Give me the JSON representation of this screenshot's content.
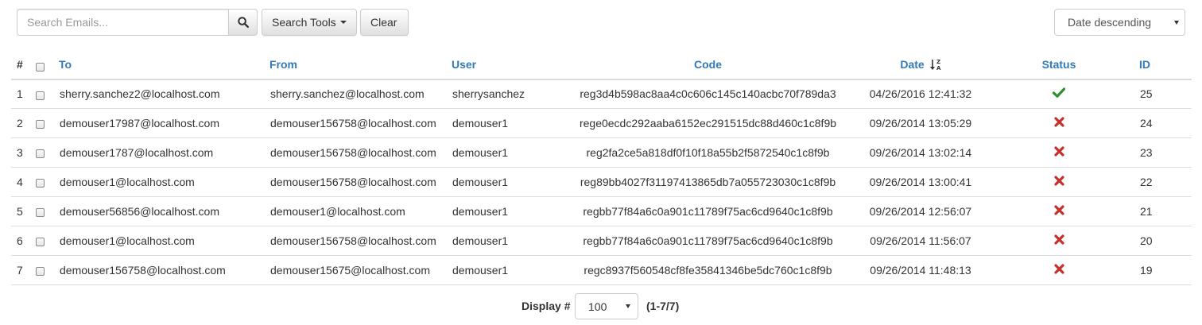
{
  "search": {
    "placeholder": "Search Emails...",
    "tools_label": "Search Tools",
    "clear_label": "Clear"
  },
  "sort": {
    "selected": "Date descending"
  },
  "table": {
    "headers": {
      "num": "#",
      "to": "To",
      "from": "From",
      "user": "User",
      "code": "Code",
      "date": "Date",
      "status": "Status",
      "id": "ID"
    },
    "rows": [
      {
        "n": "1",
        "to": "sherry.sanchez2@localhost.com",
        "from": "sherry.sanchez@localhost.com",
        "user": "sherrysanchez",
        "code": "reg3d4b598ac8aa4c0c606c145c140acbc70f789da3",
        "date": "04/26/2016 12:41:32",
        "status": "success",
        "id": "25"
      },
      {
        "n": "2",
        "to": "demouser17987@localhost.com",
        "from": "demouser156758@localhost.com",
        "user": "demouser1",
        "code": "rege0ecdc292aaba6152ec291515dc88d460c1c8f9b",
        "date": "09/26/2014 13:05:29",
        "status": "failed",
        "id": "24"
      },
      {
        "n": "3",
        "to": "demouser1787@localhost.com",
        "from": "demouser156758@localhost.com",
        "user": "demouser1",
        "code": "reg2fa2ce5a818df0f10f18a55b2f5872540c1c8f9b",
        "date": "09/26/2014 13:02:14",
        "status": "failed",
        "id": "23"
      },
      {
        "n": "4",
        "to": "demouser1@localhost.com",
        "from": "demouser156758@localhost.com",
        "user": "demouser1",
        "code": "reg89bb4027f31197413865db7a055723030c1c8f9b",
        "date": "09/26/2014 13:00:41",
        "status": "failed",
        "id": "22"
      },
      {
        "n": "5",
        "to": "demouser56856@localhost.com",
        "from": "demouser1@localhost.com",
        "user": "demouser1",
        "code": "regbb77f84a6c0a901c11789f75ac6cd9640c1c8f9b",
        "date": "09/26/2014 12:56:07",
        "status": "failed",
        "id": "21"
      },
      {
        "n": "6",
        "to": "demouser1@localhost.com",
        "from": "demouser156758@localhost.com",
        "user": "demouser1",
        "code": "regbb77f84a6c0a901c11789f75ac6cd9640c1c8f9b",
        "date": "09/26/2014 11:56:07",
        "status": "failed",
        "id": "20"
      },
      {
        "n": "7",
        "to": "demouser156758@localhost.com",
        "from": "demouser15675@localhost.com",
        "user": "demouser1",
        "code": "regc8937f560548cf8fe35841346be5dc760c1c8f9b",
        "date": "09/26/2014 11:48:13",
        "status": "failed",
        "id": "19"
      }
    ]
  },
  "footer": {
    "display_label": "Display #",
    "page_size": "100",
    "range": "(1-7/7)"
  },
  "colors": {
    "link": "#337ab7",
    "success": "#2f8f2f",
    "failed": "#c9302c",
    "border": "#dddddd"
  },
  "icons": {
    "search": "magnifier-icon",
    "sort": "sort-alpha-desc-icon",
    "success": "check-icon",
    "failed": "x-icon"
  }
}
